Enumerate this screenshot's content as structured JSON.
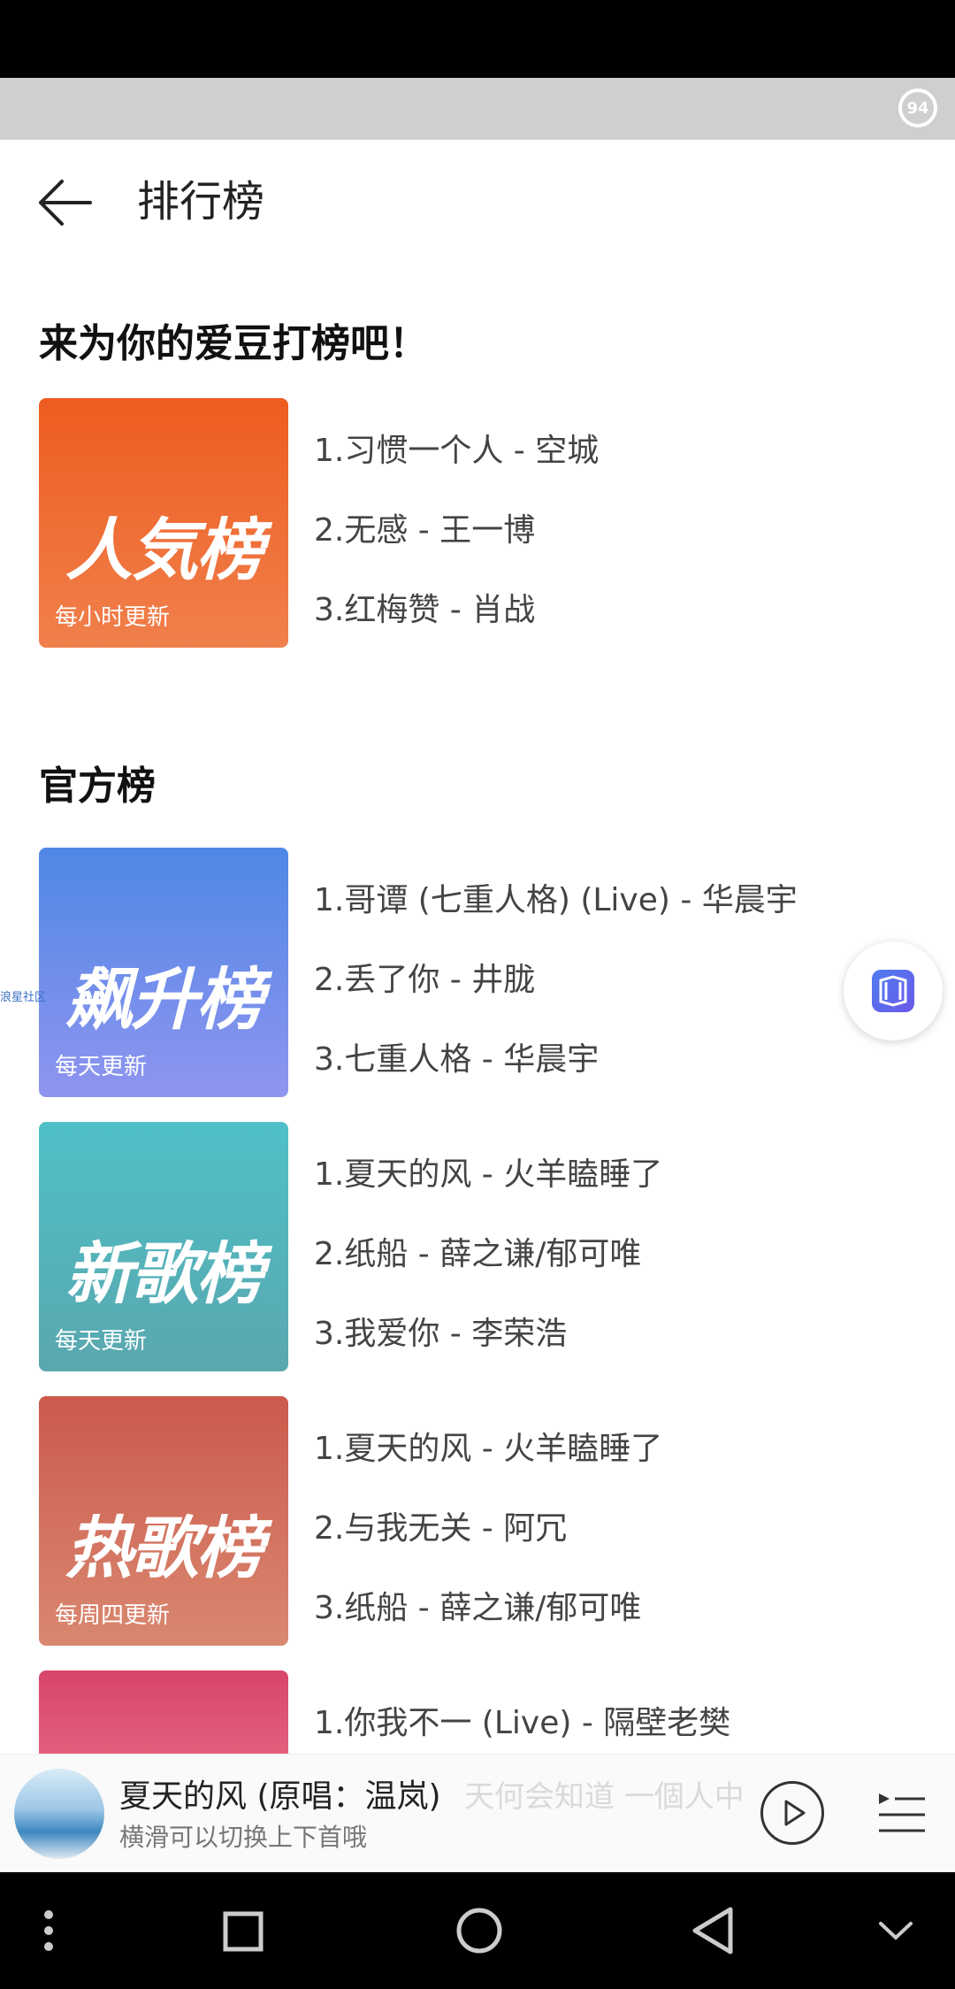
{
  "status_badge": "94",
  "header": {
    "title": "排行榜"
  },
  "sections": {
    "fan": {
      "title": "来为你的爱豆打榜吧！"
    },
    "official": {
      "title": "官方榜"
    }
  },
  "charts": [
    {
      "logo": "人気榜",
      "frequency": "每小时更新",
      "gradient": [
        "#ee5c1f",
        "#f0804c"
      ],
      "songs": [
        "1.习惯一个人 - 空城",
        "2.无感 - 王一博",
        "3.红梅赞 - 肖战"
      ]
    },
    {
      "logo": "飙升榜",
      "frequency": "每天更新",
      "gradient": [
        "#4f87e6",
        "#8f95ef"
      ],
      "songs": [
        "1.哥谭 (七重人格) (Live) - 华晨宇",
        "2.丢了你 - 井胧",
        "3.七重人格 - 华晨宇"
      ]
    },
    {
      "logo": "新歌榜",
      "frequency": "每天更新",
      "gradient": [
        "#4fc0c8",
        "#5aa7ae"
      ],
      "songs": [
        "1.夏天的风 - 火羊瞌睡了",
        "2.纸船 - 薛之谦/郁可唯",
        "3.我爱你 - 李荣浩"
      ]
    },
    {
      "logo": "热歌榜",
      "frequency": "每周四更新",
      "gradient": [
        "#cc5a4c",
        "#d98870"
      ],
      "songs": [
        "1.夏天的风 - 火羊瞌睡了",
        "2.与我无关 - 阿冗",
        "3.纸船 - 薛之谦/郁可唯"
      ]
    },
    {
      "logo": "",
      "frequency": "",
      "gradient": [
        "#d8456a",
        "#e2607d"
      ],
      "songs": [
        "1.你我不一 (Live) - 隔壁老樊"
      ]
    }
  ],
  "side_text": "浪星社区",
  "player": {
    "song_title": "夏天的风 (原唱：温岚)",
    "ghost_text": "天何会知道 一個人中",
    "hint": "横滑可以切换上下首哦"
  },
  "icons": {
    "back": "back-arrow-icon",
    "float": "cube-icon",
    "play": "play-icon",
    "playlist": "playlist-icon"
  }
}
